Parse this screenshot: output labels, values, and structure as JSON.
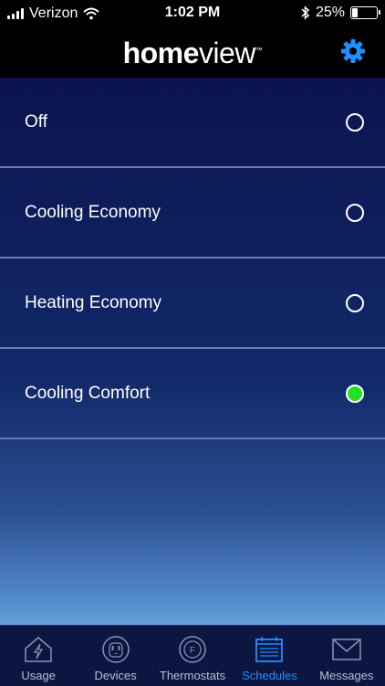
{
  "status_bar": {
    "carrier": "Verizon",
    "time": "1:02 PM",
    "battery_percent": "25%",
    "battery_level": 0.25
  },
  "header": {
    "logo_home": "home",
    "logo_view": "view",
    "logo_tm": "™"
  },
  "schedules": {
    "items": [
      {
        "label": "Off",
        "selected": false
      },
      {
        "label": "Cooling Economy",
        "selected": false
      },
      {
        "label": "Heating Economy",
        "selected": false
      },
      {
        "label": "Cooling Comfort",
        "selected": true
      }
    ]
  },
  "tabs": [
    {
      "label": "Usage",
      "icon": "house-bolt-icon",
      "active": false
    },
    {
      "label": "Devices",
      "icon": "outlet-icon",
      "active": false
    },
    {
      "label": "Thermostats",
      "icon": "thermostat-icon",
      "active": false
    },
    {
      "label": "Schedules",
      "icon": "calendar-icon",
      "active": true
    },
    {
      "label": "Messages",
      "icon": "envelope-icon",
      "active": false
    }
  ],
  "colors": {
    "accent": "#1e90ff",
    "selected_radio": "#22e022",
    "header_bg": "#000000"
  }
}
